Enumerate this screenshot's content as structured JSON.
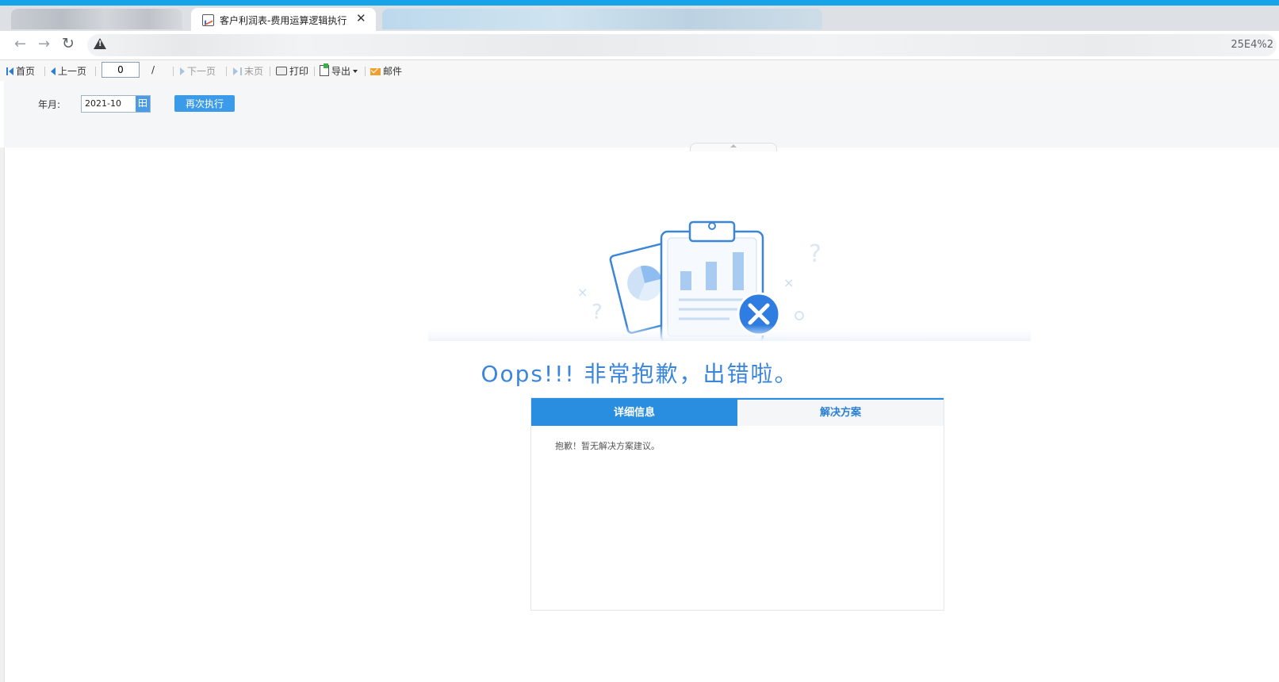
{
  "browser": {
    "tab_title": "客户利润表-费用运算逻辑执行",
    "tab_close": "✕",
    "address_tail": "25E4%2"
  },
  "toolbar": {
    "first_page": "首页",
    "prev_page": "上一页",
    "page_value": "0",
    "page_separator": "/",
    "next_page": "下一页",
    "last_page": "末页",
    "print": "打印",
    "export": "导出",
    "mail": "邮件"
  },
  "params": {
    "year_month_label": "年月:",
    "year_month_value": "2021-10",
    "run_again": "再次执行"
  },
  "error": {
    "title": "Oops!!! 非常抱歉，出错啦。",
    "tabs": [
      "详细信息",
      "解决方案"
    ],
    "message": "抱歉！暂无解决方案建议。"
  },
  "colors": {
    "accent": "#2a8ee0",
    "title_blue": "#3b86d9",
    "browser_top": "#17a3e8",
    "error_red": "#2f7de0"
  }
}
